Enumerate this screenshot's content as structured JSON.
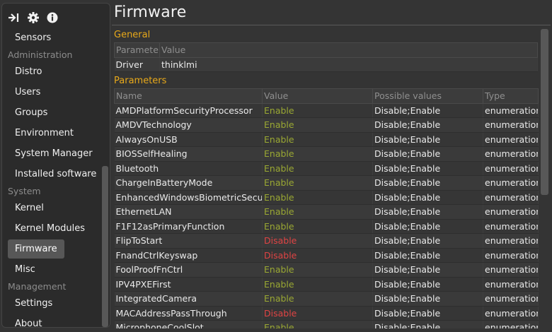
{
  "sidebar": {
    "toolbar_icons": [
      "pin-icon",
      "gear-icon",
      "info-icon"
    ],
    "items": [
      {
        "type": "item",
        "label": "Sensors"
      },
      {
        "type": "header",
        "label": "Administration"
      },
      {
        "type": "item",
        "label": "Distro"
      },
      {
        "type": "item",
        "label": "Users"
      },
      {
        "type": "item",
        "label": "Groups"
      },
      {
        "type": "item",
        "label": "Environment"
      },
      {
        "type": "item",
        "label": "System Manager"
      },
      {
        "type": "item",
        "label": "Installed software"
      },
      {
        "type": "header",
        "label": "System"
      },
      {
        "type": "item",
        "label": "Kernel"
      },
      {
        "type": "item",
        "label": "Kernel Modules"
      },
      {
        "type": "item",
        "label": "Firmware",
        "active": true
      },
      {
        "type": "item",
        "label": "Misc"
      },
      {
        "type": "header",
        "label": "Management"
      },
      {
        "type": "item",
        "label": "Settings"
      },
      {
        "type": "item",
        "label": "About"
      }
    ]
  },
  "main": {
    "title": "Firmware",
    "general": {
      "section_title": "General",
      "columns": [
        "Parameter",
        "Value"
      ],
      "rows": [
        [
          "Driver",
          "thinklmi"
        ]
      ]
    },
    "parameters": {
      "section_title": "Parameters",
      "columns": [
        "Name",
        "Value",
        "Possible values",
        "Type"
      ],
      "rows": [
        [
          "AMDPlatformSecurityProcessor",
          "Enable",
          "Disable;Enable",
          "enumeration"
        ],
        [
          "AMDVTechnology",
          "Enable",
          "Disable;Enable",
          "enumeration"
        ],
        [
          "AlwaysOnUSB",
          "Enable",
          "Disable;Enable",
          "enumeration"
        ],
        [
          "BIOSSelfHealing",
          "Enable",
          "Disable;Enable",
          "enumeration"
        ],
        [
          "Bluetooth",
          "Enable",
          "Disable;Enable",
          "enumeration"
        ],
        [
          "ChargeInBatteryMode",
          "Enable",
          "Disable;Enable",
          "enumeration"
        ],
        [
          "EnhancedWindowsBiometricSecurity",
          "Enable",
          "Disable;Enable",
          "enumeration"
        ],
        [
          "EthernetLAN",
          "Enable",
          "Disable;Enable",
          "enumeration"
        ],
        [
          "F1F12asPrimaryFunction",
          "Enable",
          "Disable;Enable",
          "enumeration"
        ],
        [
          "FlipToStart",
          "Disable",
          "Disable;Enable",
          "enumeration"
        ],
        [
          "FnandCtrlKeyswap",
          "Disable",
          "Disable;Enable",
          "enumeration"
        ],
        [
          "FoolProofFnCtrl",
          "Enable",
          "Disable;Enable",
          "enumeration"
        ],
        [
          "IPV4PXEFirst",
          "Enable",
          "Disable;Enable",
          "enumeration"
        ],
        [
          "IntegratedCamera",
          "Enable",
          "Disable;Enable",
          "enumeration"
        ],
        [
          "MACAddressPassThrough",
          "Disable",
          "Disable;Enable",
          "enumeration"
        ],
        [
          "MicrophoneCoolSlot",
          "Enable",
          "Disable;Enable",
          "enumeration"
        ]
      ]
    },
    "colors": {
      "enable": "#9aa833",
      "disable": "#e04444",
      "section_title": "#e8a91a"
    }
  }
}
